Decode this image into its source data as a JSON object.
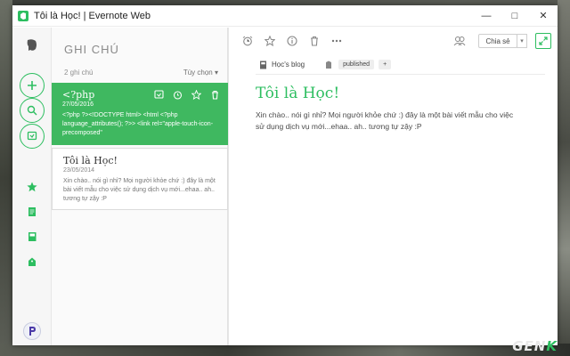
{
  "window": {
    "title": "Tôi là Học! | Evernote Web"
  },
  "notes_pane": {
    "heading": "GHI CHÚ",
    "count": "2 ghi chú",
    "options": "Tùy chọn ▾"
  },
  "notes": [
    {
      "title": "<?php",
      "date": "27/05/2016",
      "snippet": "<?php ?><!DOCTYPE html> <html <?php language_attributes(); ?>> <link rel=\"apple-touch-icon-precomposed\""
    },
    {
      "title": "Tôi là Học!",
      "date": "23/05/2014",
      "snippet": "Xin chào.. nói gì nhỉ? Mọi người khỏe chứ :) đây là một bài viết mẫu cho việc sử dụng dịch vụ mới...ehaa.. ah.. tương tự zậy :P"
    }
  ],
  "editor": {
    "notebook": "Học's blog",
    "tag": "published",
    "add_tag": "+",
    "share_label": "Chia sẻ",
    "note_title": "Tôi là Học!",
    "note_body": "Xin chào.. nói gì nhỉ? Mọi người khỏe chứ :) đây là một bài viết mẫu cho việc sử dụng dịch vụ mới...ehaa.. ah.. tương tự zậy :P"
  },
  "watermark": {
    "brand_a": "GEN",
    "brand_b": "K"
  },
  "colors": {
    "accent": "#2dbe60",
    "active_note": "#3fb860"
  }
}
